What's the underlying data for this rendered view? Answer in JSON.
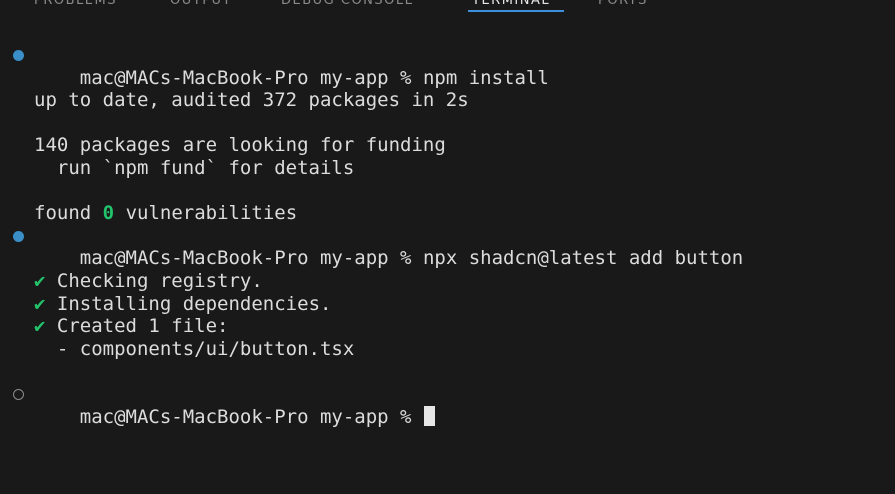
{
  "panel_tabs": [
    {
      "label": "PROBLEMS"
    },
    {
      "label": "OUTPUT"
    },
    {
      "label": "DEBUG CONSOLE"
    },
    {
      "label": "TERMINAL",
      "active": true
    },
    {
      "label": "PORTS"
    }
  ],
  "terminal": {
    "prompt": "mac@MACs-MacBook-Pro my-app %",
    "command_1": "npm install",
    "output_1": "up to date, audited 372 packages in 2s",
    "output_2": "140 packages are looking for funding",
    "output_3": "  run `npm fund` for details",
    "found_prefix": "found",
    "vuln_count": "0",
    "found_suffix": "vulnerabilities",
    "command_2": "npx shadcn@latest add button",
    "check_mark": "✔",
    "step_1": "Checking registry.",
    "step_2": "Installing dependencies.",
    "step_3": "Created 1 file:",
    "created_file": "  - components/ui/button.tsx"
  },
  "colors": {
    "background": "#191919",
    "success": "#22c36b",
    "prompt_dot": "#3a8fc8",
    "active_tab_underline": "#3d8fdc"
  }
}
